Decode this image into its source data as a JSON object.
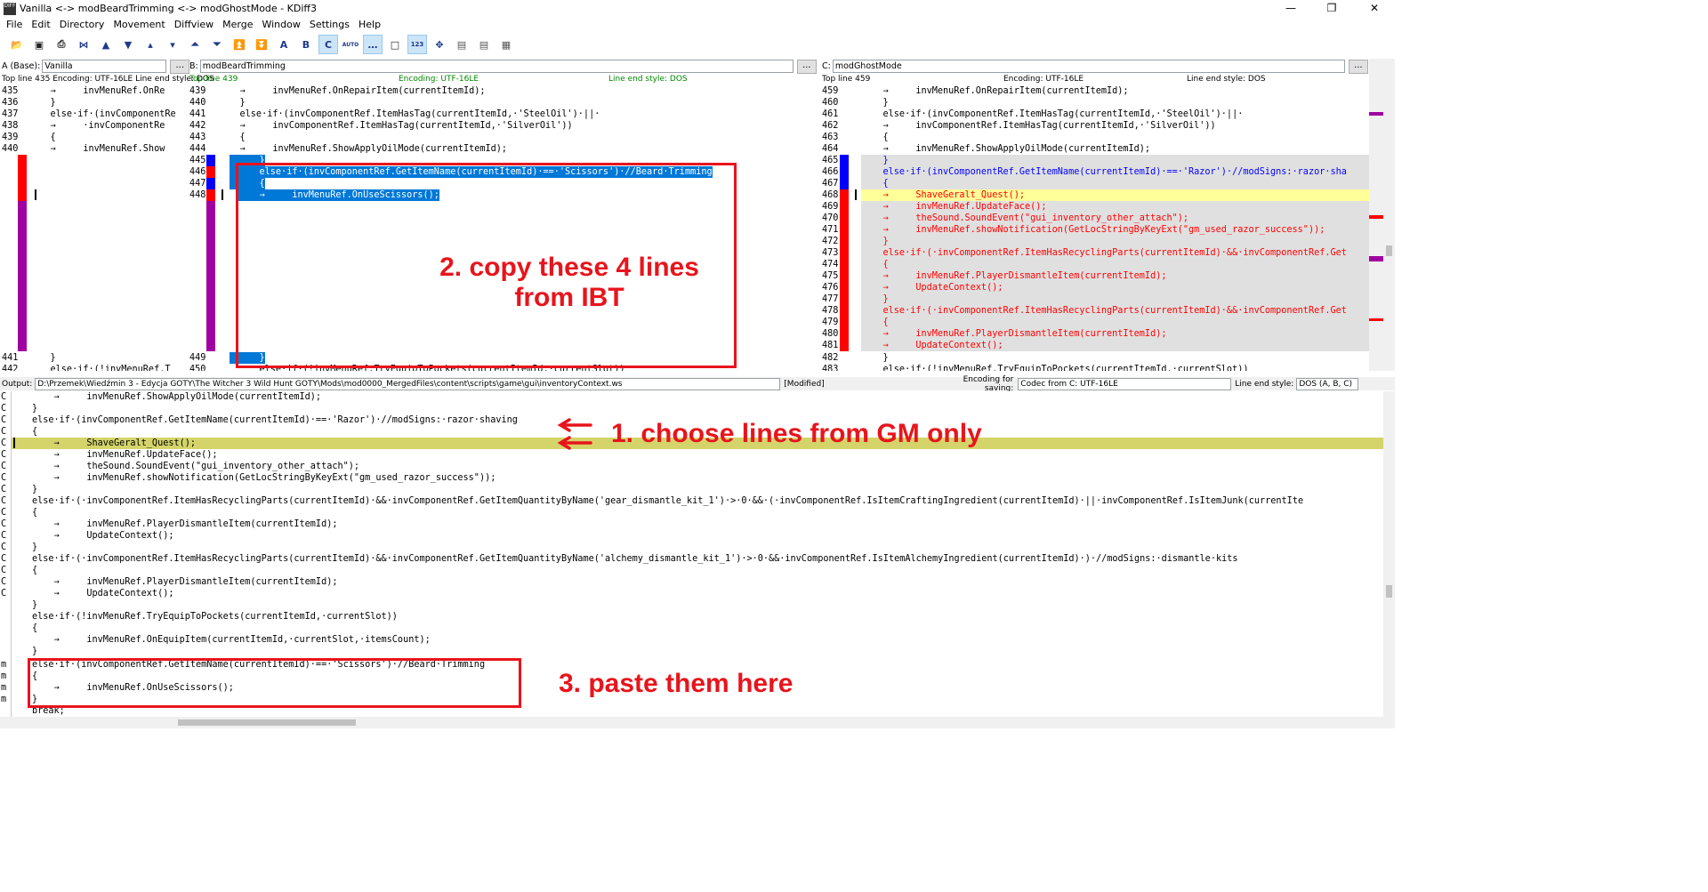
{
  "window": {
    "title": "Vanilla <-> modBeardTrimming <-> modGhostMode - KDiff3",
    "app_icon_text": "DIFF"
  },
  "menu": [
    "File",
    "Edit",
    "Directory",
    "Movement",
    "Diffview",
    "Merge",
    "Window",
    "Settings",
    "Help"
  ],
  "toolbar": {
    "icons": [
      "open-icon",
      "save-icon",
      "print-icon",
      "goto-top-icon",
      "goto-prev-conflict-icon",
      "goto-next-conflict-icon",
      "goto-prev-delta-icon",
      "goto-next-delta-icon",
      "goto-prev-unsolved-icon",
      "goto-next-unsolved-icon",
      "goto-first-icon",
      "goto-last-icon",
      "select-a-icon",
      "select-b-icon",
      "select-c-icon",
      "auto-solve-icon",
      "show-whitespace-icon",
      "show-whitespace-chars-icon",
      "show-line-numbers-icon",
      "overview-icon",
      "split-horizontal-icon",
      "split-vertical-icon",
      "split-three-icon"
    ],
    "labels": {
      "a": "A",
      "b": "B",
      "c": "C",
      "auto": "AUTO",
      "num": "123"
    }
  },
  "pane_a": {
    "label": "A (Base):",
    "file": "Vanilla",
    "browse": "...",
    "info": "Top line 435 Encoding: UTF-16LE Line end style: DOS",
    "lines": [
      {
        "n": "435",
        "t": "    →     invMenuRef.OnRe"
      },
      {
        "n": "436",
        "t": "    }"
      },
      {
        "n": "437",
        "t": "    else·if·(invComponentRe"
      },
      {
        "n": "438",
        "t": "    →     ·invComponentRe"
      },
      {
        "n": "439",
        "t": "    {"
      },
      {
        "n": "440",
        "t": "    →     invMenuRef.Show"
      },
      {
        "n": "441",
        "t": "    }"
      },
      {
        "n": "442",
        "t": "    else·if·(!invMenuRef.T"
      }
    ]
  },
  "pane_b": {
    "label": "B:",
    "file": "modBeardTrimming",
    "browse": "...",
    "info_top": "Top line 439",
    "info_enc": "Encoding: UTF-16LE",
    "info_eol": "Line end style: DOS",
    "lines": [
      {
        "n": "439",
        "t": "    →     invMenuRef.OnRepairItem(currentItemId);"
      },
      {
        "n": "440",
        "t": "    }"
      },
      {
        "n": "441",
        "t": "    else·if·(invComponentRef.ItemHasTag(currentItemId,·'SteelOil')·||·"
      },
      {
        "n": "442",
        "t": "    →     invComponentRef.ItemHasTag(currentItemId,·'SilverOil'))"
      },
      {
        "n": "443",
        "t": "    {"
      },
      {
        "n": "444",
        "t": "    →     invMenuRef.ShowApplyOilMode(currentItemId);"
      },
      {
        "n": "445",
        "t": "    }"
      },
      {
        "n": "446",
        "t": "    else·if·(invComponentRef.GetItemName(currentItemId)·==·'Scissors')·//Beard·Trimming"
      },
      {
        "n": "447",
        "t": "    {"
      },
      {
        "n": "448",
        "t": "    →     invMenuRef.OnUseScissors();"
      },
      {
        "n": "449",
        "t": "    }"
      },
      {
        "n": "450",
        "t": "    else·if·(!invMenuRef.TryEquipToPockets(currentItemId,·currentSlot))"
      }
    ]
  },
  "pane_c": {
    "label": "C:",
    "file": "modGhostMode",
    "browse": "...",
    "info_top": "Top line 459",
    "info_enc": "Encoding: UTF-16LE",
    "info_eol": "Line end style: DOS",
    "lines": [
      {
        "n": "459",
        "t": "    →     invMenuRef.OnRepairItem(currentItemId);"
      },
      {
        "n": "460",
        "t": "    }"
      },
      {
        "n": "461",
        "t": "    else·if·(invComponentRef.ItemHasTag(currentItemId,·'SteelOil')·||·"
      },
      {
        "n": "462",
        "t": "    →     invComponentRef.ItemHasTag(currentItemId,·'SilverOil'))"
      },
      {
        "n": "463",
        "t": "    {"
      },
      {
        "n": "464",
        "t": "    →     invMenuRef.ShowApplyOilMode(currentItemId);"
      },
      {
        "n": "465",
        "t": "    }"
      },
      {
        "n": "466",
        "t": "    else·if·(invComponentRef.GetItemName(currentItemId)·==·'Razor')·//modSigns:·razor·sha"
      },
      {
        "n": "467",
        "t": "    {"
      },
      {
        "n": "468",
        "t": "    →     ShaveGeralt_Quest();"
      },
      {
        "n": "469",
        "t": "    →     invMenuRef.UpdateFace();"
      },
      {
        "n": "470",
        "t": "    →     theSound.SoundEvent(\"gui_inventory_other_attach\");"
      },
      {
        "n": "471",
        "t": "    →     invMenuRef.showNotification(GetLocStringByKeyExt(\"gm_used_razor_success\"));"
      },
      {
        "n": "472",
        "t": "    }"
      },
      {
        "n": "473",
        "t": "    else·if·(·invComponentRef.ItemHasRecyclingParts(currentItemId)·&&·invComponentRef.Get"
      },
      {
        "n": "474",
        "t": "    {"
      },
      {
        "n": "475",
        "t": "    →     invMenuRef.PlayerDismantleItem(currentItemId);"
      },
      {
        "n": "476",
        "t": "    →     UpdateContext();"
      },
      {
        "n": "477",
        "t": "    }"
      },
      {
        "n": "478",
        "t": "    else·if·(·invComponentRef.ItemHasRecyclingParts(currentItemId)·&&·invComponentRef.Get"
      },
      {
        "n": "479",
        "t": "    {"
      },
      {
        "n": "480",
        "t": "    →     invMenuRef.PlayerDismantleItem(currentItemId);"
      },
      {
        "n": "481",
        "t": "    →     UpdateContext();"
      },
      {
        "n": "482",
        "t": "    }"
      },
      {
        "n": "483",
        "t": "    else·if·(!invMenuRef.TryEquipToPockets(currentItemId,·currentSlot))"
      }
    ]
  },
  "output": {
    "label": "Output:",
    "path": "D:\\Przemek\\Wiedźmin 3 - Edycja GOTY\\The Witcher 3 Wild Hunt GOTY\\Mods\\mod0000_MergedFiles\\content\\scripts\\game\\gui\\inventoryContext.ws",
    "modified": "[Modified]",
    "enc_label": "Encoding for saving:",
    "enc_value": "Codec from C: UTF-16LE",
    "eol_label": "Line end style:",
    "eol_value": "DOS (A, B, C)",
    "lines": [
      {
        "s": "C",
        "t": "    →     invMenuRef.ShowApplyOilMode(currentItemId);"
      },
      {
        "s": "C",
        "t": "}"
      },
      {
        "s": "C",
        "t": "else·if·(invComponentRef.GetItemName(currentItemId)·==·'Razor')·//modSigns:·razor·shaving"
      },
      {
        "s": "C",
        "t": "{"
      },
      {
        "s": "C",
        "t": "    →     ShaveGeralt_Quest();"
      },
      {
        "s": "C",
        "t": "    →     invMenuRef.UpdateFace();"
      },
      {
        "s": "C",
        "t": "    →     theSound.SoundEvent(\"gui_inventory_other_attach\");"
      },
      {
        "s": "C",
        "t": "    →     invMenuRef.showNotification(GetLocStringByKeyExt(\"gm_used_razor_success\"));"
      },
      {
        "s": "C",
        "t": "}"
      },
      {
        "s": "C",
        "t": "else·if·(·invComponentRef.ItemHasRecyclingParts(currentItemId)·&&·invComponentRef.GetItemQuantityByName('gear_dismantle_kit_1')·>·0·&&·(·invComponentRef.IsItemCraftingIngredient(currentItemId)·||·invComponentRef.IsItemJunk(currentIte"
      },
      {
        "s": "C",
        "t": "{"
      },
      {
        "s": "C",
        "t": "    →     invMenuRef.PlayerDismantleItem(currentItemId);"
      },
      {
        "s": "C",
        "t": "    →     UpdateContext();"
      },
      {
        "s": "C",
        "t": "}"
      },
      {
        "s": "C",
        "t": "else·if·(·invComponentRef.ItemHasRecyclingParts(currentItemId)·&&·invComponentRef.GetItemQuantityByName('alchemy_dismantle_kit_1')·>·0·&&·invComponentRef.IsItemAlchemyIngredient(currentItemId)·)·//modSigns:·dismantle·kits"
      },
      {
        "s": "C",
        "t": "{"
      },
      {
        "s": "C",
        "t": "    →     invMenuRef.PlayerDismantleItem(currentItemId);"
      },
      {
        "s": "C",
        "t": "    →     UpdateContext();"
      },
      {
        "s": "",
        "t": "}"
      },
      {
        "s": "",
        "t": "else·if·(!invMenuRef.TryEquipToPockets(currentItemId,·currentSlot))"
      },
      {
        "s": "",
        "t": "{"
      },
      {
        "s": "",
        "t": "    →     invMenuRef.OnEquipItem(currentItemId,·currentSlot,·itemsCount);"
      },
      {
        "s": "",
        "t": "}"
      },
      {
        "s": "m",
        "t": "else·if·(invComponentRef.GetItemName(currentItemId)·==·'Scissors')·//Beard·Trimming"
      },
      {
        "s": "m",
        "t": "{"
      },
      {
        "s": "m",
        "t": "    →     invMenuRef.OnUseScissors();"
      },
      {
        "s": "m",
        "t": "}"
      },
      {
        "s": "",
        "t": "break;"
      }
    ]
  },
  "annotations": {
    "step1": "1. choose lines from GM only",
    "step2_line1": "2. copy these 4 lines",
    "step2_line2": "from IBT",
    "step3": "3. paste them here"
  },
  "colors": {
    "red": "#ff0000",
    "blue": "#0000ff",
    "purple": "#a000a0",
    "annotation": "#e8141c",
    "selection": "#0078d7",
    "current_line": "#d4d46a"
  }
}
